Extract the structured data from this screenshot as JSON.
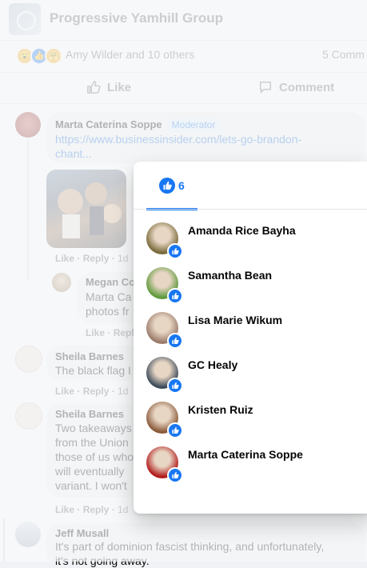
{
  "header": {
    "group_name": "Progressive Yamhill Group"
  },
  "reaction_summary": {
    "text": "Amy Wilder and 10 others",
    "comments": "5 Comm"
  },
  "actions": {
    "like": "Like",
    "comment": "Comment"
  },
  "comments": [
    {
      "author": "Marta Caterina Soppe",
      "badge": "Moderator",
      "link_line1": "https://www.businessinsider.com/lets-go-brandon-",
      "link_line2": "chant...",
      "like": "Like",
      "reply": "Reply",
      "time": "1d"
    },
    {
      "author": "Megan Co",
      "line1": "Marta Ca",
      "line2": "photos fr",
      "like": "Like",
      "reply": "Reply"
    },
    {
      "author": "Sheila Barnes",
      "line1": "The black flag I",
      "like": "Like",
      "reply": "Reply",
      "time": "1d"
    },
    {
      "author": "Sheila Barnes",
      "line1": "Two takeaways",
      "line2": "from the Union",
      "line3": "those of us who",
      "line4": "will eventually",
      "line5": "variant. I won't",
      "like": "Like",
      "reply": "Reply",
      "time": "1d"
    },
    {
      "author": "Jeff Musall",
      "line1": "It's part of dominion fascist thinking, and unfortunately,",
      "line2": "it's not going away."
    }
  ],
  "reactions_popup": {
    "tab_count": "6",
    "people": [
      {
        "name": "Amanda Rice Bayha",
        "avatar_color": "#7a6a3a"
      },
      {
        "name": "Samantha Bean",
        "avatar_color": "#5f9a3c"
      },
      {
        "name": "Lisa Marie Wikum",
        "avatar_color": "#9a7b6a"
      },
      {
        "name": "GC Healy",
        "avatar_color": "#3b4a5a"
      },
      {
        "name": "Kristen Ruiz",
        "avatar_color": "#8a5a3a"
      },
      {
        "name": "Marta Caterina Soppe",
        "avatar_color": "#b11a1a"
      }
    ]
  },
  "colors": {
    "accent": "#1877f2",
    "link": "#216fdb",
    "muted": "#65676b"
  }
}
